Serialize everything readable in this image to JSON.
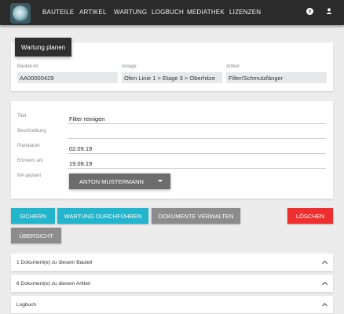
{
  "nav": {
    "items": [
      "BAUTEILE",
      "ARTIKEL",
      "WARTUNG",
      "LOGBUCH",
      "MEDIATHEK",
      "LIZENZEN"
    ],
    "help_icon": "help-icon",
    "user_icon": "user-icon"
  },
  "header_card": {
    "tab_label": "Wartung planen",
    "fields": [
      {
        "label": "Bauteil-Nr.",
        "value": "AA00000429"
      },
      {
        "label": "Anlage",
        "value": "Ofen Linie 1 > Etage 3 > Oberhitze"
      },
      {
        "label": "Artikel",
        "value": "Filter/Schmutzfänger"
      }
    ]
  },
  "form": {
    "titel_label": "Titel",
    "titel_value": "Filter reinigen",
    "beschreibung_label": "Beschreibung",
    "beschreibung_value": "",
    "plandatum_label": "Plandatum",
    "plandatum_value": "02.09.19",
    "erinnern_label": "Erinnern am",
    "erinnern_value": "19.08.19",
    "ma_label": "MA geplant",
    "ma_value": "ANTON MUSTERMANN"
  },
  "actions": {
    "sichern": "SICHERN",
    "durchfuehren": "WARTUNG DURCHFÜHREN",
    "dokumente": "DOKUMENTE VERWALTEN",
    "loeschen": "LÖSCHEN",
    "uebersicht": "ÜBERSICHT"
  },
  "accordions": [
    {
      "label": "1 Dokument(e) zu diesem Bauteil"
    },
    {
      "label": "6 Dokument(e) zu diesem Artikel"
    },
    {
      "label": "Logbuch"
    }
  ],
  "colors": {
    "nav_bg": "#2b2b2b",
    "accent_teal": "#23b5cc",
    "secondary_grey": "#8c8c8c",
    "danger_red": "#ee2f2f"
  }
}
